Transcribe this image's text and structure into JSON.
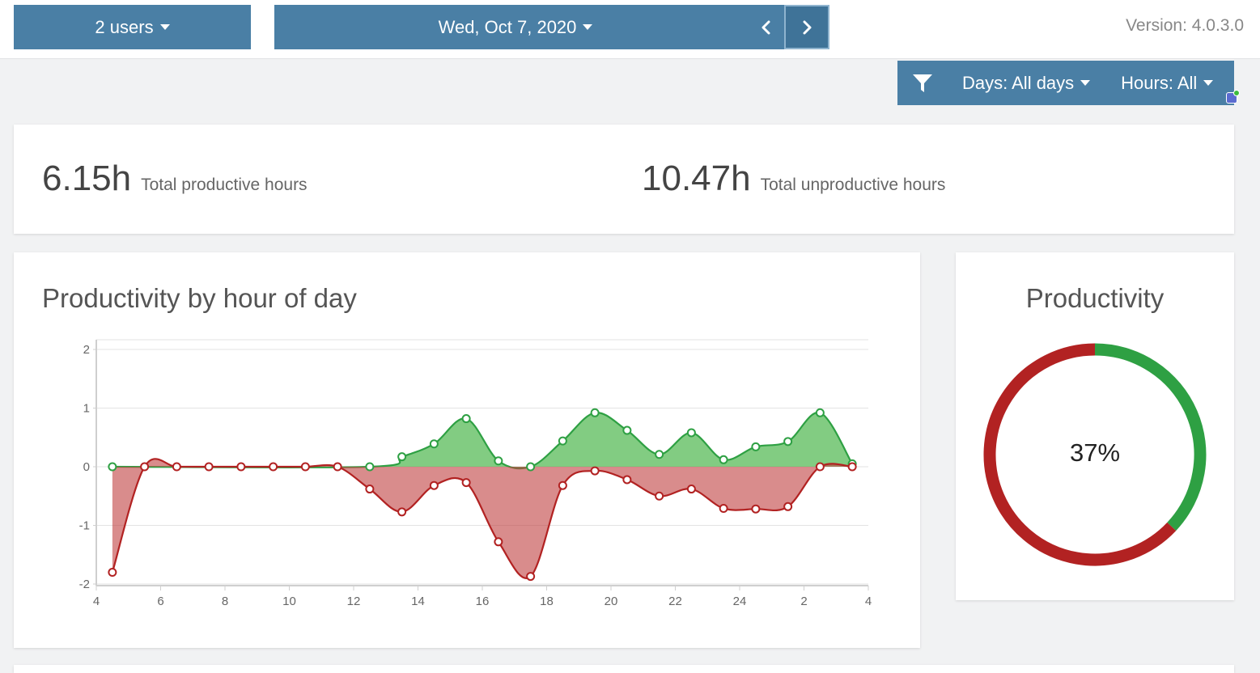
{
  "header": {
    "users_label": "2 users",
    "date_label": "Wed, Oct 7, 2020",
    "prev_icon": "chevron-left-icon",
    "next_icon": "chevron-right-icon",
    "version": "Version: 4.0.3.0"
  },
  "filters": {
    "filter_icon": "funnel-icon",
    "days_label": "Days: All days",
    "hours_label": "Hours: All"
  },
  "totals": {
    "productive_value": "6.15h",
    "productive_label": "Total productive hours",
    "unproductive_value": "10.47h",
    "unproductive_label": "Total unproductive hours"
  },
  "hourly_card": {
    "title": "Productivity by hour of day"
  },
  "productivity_card": {
    "title": "Productivity",
    "percent_label": "37%"
  },
  "colors": {
    "accent": "#4a7fa5",
    "productive": "#2ea043",
    "unproductive": "#b22222"
  },
  "chart_data": [
    {
      "type": "area",
      "title": "Productivity by hour of day",
      "xlim": [
        4,
        28
      ],
      "ylim": [
        -2,
        2
      ],
      "x_ticks": [
        4,
        6,
        8,
        10,
        12,
        14,
        16,
        18,
        20,
        22,
        24,
        26,
        28
      ],
      "x_tick_labels": [
        "4",
        "6",
        "8",
        "10",
        "12",
        "14",
        "16",
        "18",
        "20",
        "22",
        "24",
        "2",
        "4"
      ],
      "y_ticks": [
        -2,
        -1,
        0,
        1,
        2
      ],
      "grid": true,
      "series": [
        {
          "color": "#2ea043",
          "x": [
            4.5,
            12.5,
            13.5,
            14.5,
            15.5,
            16.5,
            17.5,
            18.5,
            19.5,
            20.5,
            21.5,
            22.5,
            23.5,
            24.5,
            25.5,
            26.5,
            27.5
          ],
          "values": [
            0,
            0,
            0.17,
            0.39,
            0.82,
            0.1,
            0,
            0.44,
            0.92,
            0.62,
            0.21,
            0.58,
            0.12,
            0.34,
            0.43,
            0.92,
            0.05
          ]
        },
        {
          "color": "#b22222",
          "x": [
            4.5,
            5.5,
            6.5,
            7.5,
            8.5,
            9.5,
            10.5,
            11.5,
            12.5,
            13.5,
            14.5,
            15.5,
            16.5,
            17.5,
            18.5,
            19.5,
            20.5,
            21.5,
            22.5,
            23.5,
            24.5,
            25.5,
            26.5,
            27.5
          ],
          "values": [
            -1.8,
            0,
            0,
            0,
            0,
            0,
            0,
            0,
            -0.38,
            -0.77,
            -0.32,
            -0.27,
            -1.28,
            -1.87,
            -0.32,
            -0.07,
            -0.22,
            -0.5,
            -0.38,
            -0.71,
            -0.72,
            -0.68,
            0,
            0
          ]
        }
      ]
    },
    {
      "type": "pie",
      "title": "Productivity",
      "center_label": "37%",
      "slices": [
        {
          "value": 37,
          "color": "#2ea043"
        },
        {
          "value": 63,
          "color": "#b22222"
        }
      ]
    }
  ]
}
